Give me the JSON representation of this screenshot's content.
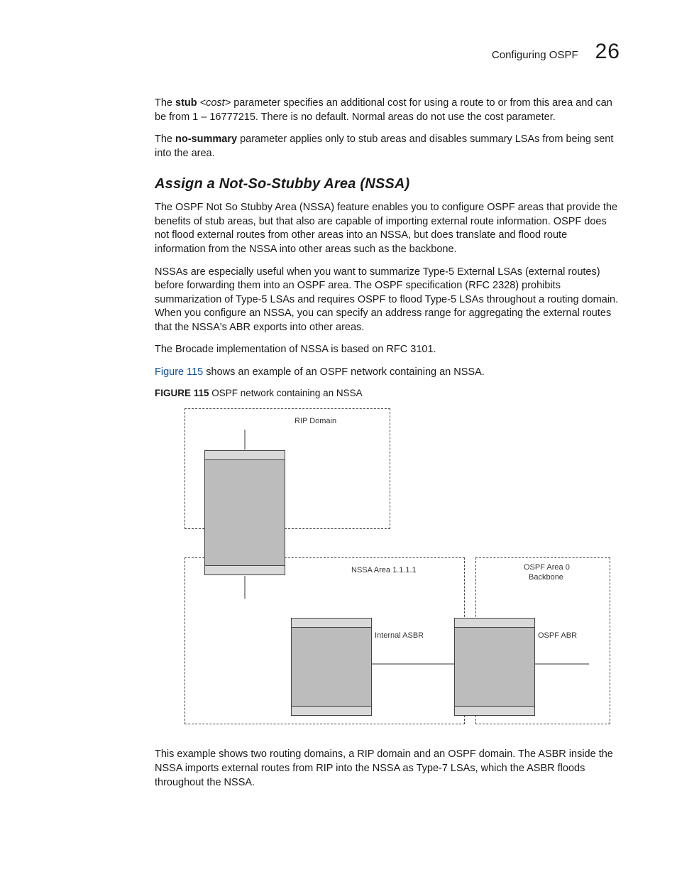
{
  "header": {
    "title": "Configuring OSPF",
    "chapter": "26"
  },
  "para1": {
    "lead": "The ",
    "b1": "stub",
    "i1": " <cost>",
    "rest": " parameter specifies an additional cost for using a route to or from this area and can be from 1 – 16777215. There is no default. Normal areas do not use the cost parameter."
  },
  "para2": {
    "lead": "The ",
    "b1": "no-summary",
    "rest": " parameter applies only to stub areas and disables summary LSAs from being sent into the area."
  },
  "section_title": "Assign a Not-So-Stubby Area (NSSA)",
  "para3": "The OSPF Not So Stubby Area (NSSA) feature enables you to configure OSPF areas that provide the benefits of stub areas, but that also are capable of importing external route information. OSPF does not flood external routes from other areas into an NSSA, but does translate and flood route information from the NSSA into other areas such as the backbone.",
  "para4": "NSSAs are especially useful when you want to summarize Type-5 External LSAs (external routes) before forwarding them into an OSPF area. The OSPF specification (RFC 2328) prohibits summarization of Type-5 LSAs and requires OSPF to flood Type-5 LSAs throughout a routing domain. When you configure an NSSA, you can specify an address range for aggregating the external routes that the NSSA's ABR exports into other areas.",
  "para5": "The Brocade implementation of NSSA is based on RFC 3101.",
  "para6": {
    "link": "Figure 115",
    "rest": " shows an example of an OSPF network containing an NSSA."
  },
  "figcap": {
    "lead": "FIGURE 115",
    "rest": "   OSPF network containing an NSSA"
  },
  "diagram": {
    "rip_domain": "RIP Domain",
    "nssa_area": "NSSA Area 1.1.1.1",
    "ospf_area0_l1": "OSPF Area 0",
    "ospf_area0_l2": "Backbone",
    "internal_asbr": "Internal ASBR",
    "ospf_abr": "OSPF ABR"
  },
  "para7": "This example shows two routing domains, a RIP domain and an OSPF domain. The ASBR inside the NSSA imports external routes from RIP into the NSSA as Type-7 LSAs, which the ASBR floods throughout the NSSA."
}
